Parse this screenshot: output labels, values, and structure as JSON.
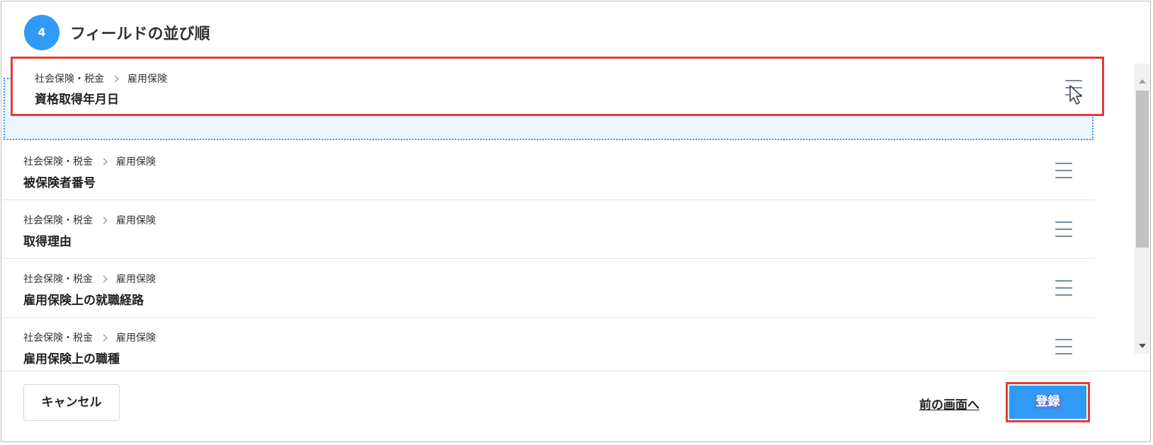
{
  "section": {
    "step_number": "4",
    "title": "フィールドの並び順"
  },
  "dragging_item": {
    "category": "社会保険・税金",
    "subcategory": "雇用保険",
    "name": "資格取得年月日"
  },
  "rows": [
    {
      "category": "社会保険・税金",
      "subcategory": "雇用保険",
      "name": "被保険者番号"
    },
    {
      "category": "社会保険・税金",
      "subcategory": "雇用保険",
      "name": "取得理由"
    },
    {
      "category": "社会保険・税金",
      "subcategory": "雇用保険",
      "name": "雇用保険上の就職経路"
    },
    {
      "category": "社会保険・税金",
      "subcategory": "雇用保険",
      "name": "雇用保険上の職種"
    }
  ],
  "footer": {
    "cancel_label": "キャンセル",
    "prev_label": "前の画面へ",
    "submit_label": "登録"
  },
  "colors": {
    "accent": "#2f9bf6",
    "highlight_border": "#e53935"
  },
  "icons": {
    "handle": "drag-handle-icon",
    "separator": "chevron-right-icon",
    "cursor": "mouse-pointer-icon"
  }
}
